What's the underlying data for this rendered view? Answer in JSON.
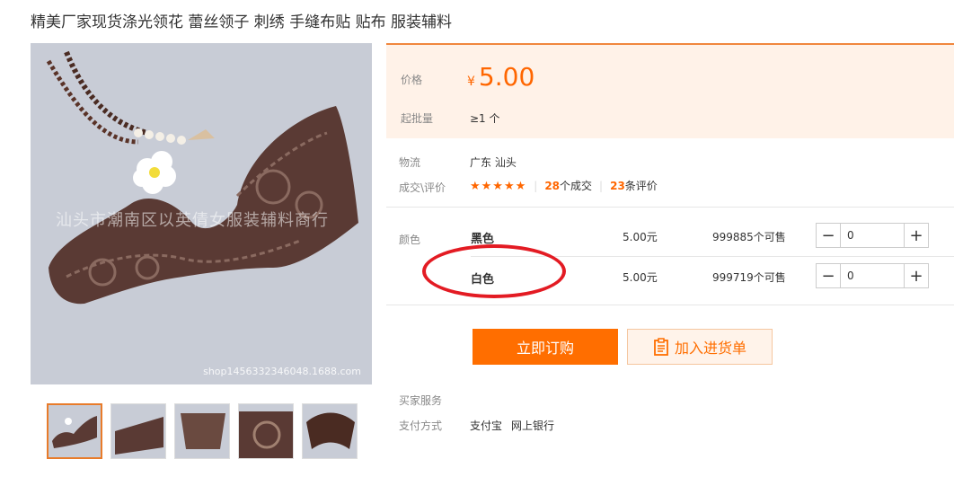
{
  "product": {
    "title": "精美厂家现货涤光领花 蕾丝领子 刺绣 手缝布贴 贴布 服装辅料",
    "watermark": "汕头市潮南区以英倩女服装辅料商行",
    "shop_url": "shop1456332346048.1688.com"
  },
  "price_panel": {
    "price_label": "价格",
    "currency": "¥",
    "price": "5.00",
    "moq_label": "起批量",
    "moq_value": "≥1 个"
  },
  "logistics": {
    "label": "物流",
    "value": "广东 汕头"
  },
  "reviews": {
    "label": "成交\\评价",
    "stars": "★★★★★",
    "deals_count": "28",
    "deals_suffix": "个成交",
    "reviews_count": "23",
    "reviews_suffix": "条评价"
  },
  "sku": {
    "label": "颜色",
    "rows": [
      {
        "name": "黑色",
        "price": "5.00元",
        "stock": "999885个可售",
        "qty": "0"
      },
      {
        "name": "白色",
        "price": "5.00元",
        "stock": "999719个可售",
        "qty": "0"
      }
    ],
    "minus": "−",
    "plus": "+"
  },
  "actions": {
    "order_label": "立即订购",
    "cart_label": "加入进货单"
  },
  "services": {
    "buyer_label": "买家服务",
    "payment_label": "支付方式",
    "payment_methods": [
      "支付宝",
      "网上银行"
    ]
  },
  "colors": {
    "accent": "#ff6600",
    "highlight": "#e31b23"
  },
  "icons": {
    "cart": "clipboard-icon"
  }
}
